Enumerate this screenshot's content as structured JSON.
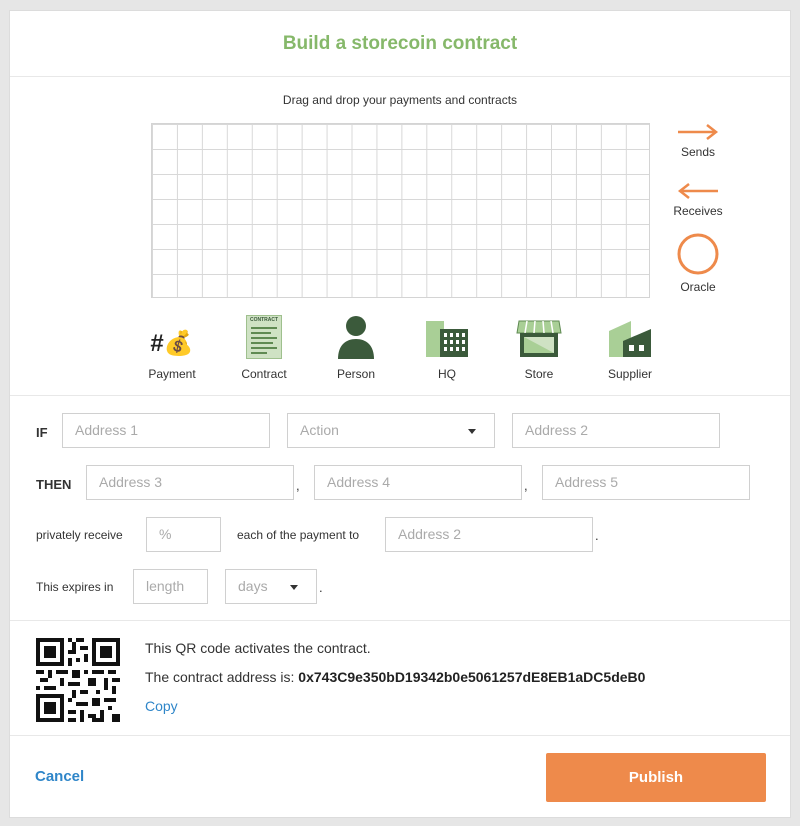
{
  "header": {
    "title": "Build a storecoin contract"
  },
  "builder": {
    "hint": "Drag and drop your payments and contracts",
    "legend": [
      {
        "label": "Sends",
        "icon": "arrow-right-icon"
      },
      {
        "label": "Receives",
        "icon": "arrow-left-icon"
      },
      {
        "label": "Oracle",
        "icon": "circle-icon"
      }
    ],
    "palette": [
      {
        "label": "Payment",
        "icon": "payment-icon"
      },
      {
        "label": "Contract",
        "icon": "contract-icon"
      },
      {
        "label": "Person",
        "icon": "person-icon"
      },
      {
        "label": "HQ",
        "icon": "hq-building-icon"
      },
      {
        "label": "Store",
        "icon": "store-icon"
      },
      {
        "label": "Supplier",
        "icon": "supplier-factory-icon"
      }
    ],
    "payment_glyph": "#💰",
    "contract_badge": "CONTRACT"
  },
  "form": {
    "if_label": "IF",
    "then_label": "THEN",
    "address1_placeholder": "Address 1",
    "action_value": "Action",
    "address2_placeholder": "Address 2",
    "address3_placeholder": "Address 3",
    "address4_placeholder": "Address 4",
    "address5_placeholder": "Address 5",
    "comma": ",",
    "privately_receive": "privately receive",
    "percent_placeholder": "%",
    "each_payment_to": "each of the payment to",
    "recipient_placeholder": "Address 2",
    "period": ".",
    "expires_label": "This expires in",
    "length_placeholder": "length",
    "unit_value": "days"
  },
  "qr_section": {
    "activates_text": "This QR code activates the contract.",
    "address_prefix": "The contract address is:",
    "contract_address": "0x743C9e350bD19342b0e5061257dE8EB1aDC5deB0",
    "copy_label": "Copy"
  },
  "footer": {
    "cancel_label": "Cancel",
    "publish_label": "Publish"
  },
  "colors": {
    "accent": "#ee8a4b",
    "title_green": "#86b86a",
    "link_blue": "#2f86c9",
    "icon_green": "#3b5a3b"
  }
}
